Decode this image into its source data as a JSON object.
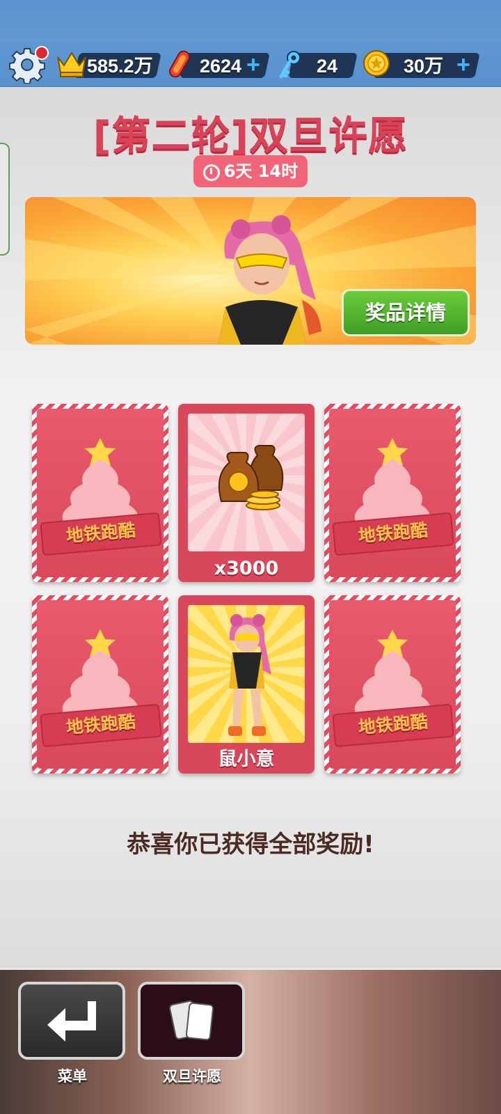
{
  "resources": {
    "score": "585.2万",
    "hoverboards": "2624",
    "keys": "24",
    "coins": "30万"
  },
  "event": {
    "title": "[第二轮]双旦许愿",
    "timer": "6天 14时",
    "detail_button": "奖品详情"
  },
  "cards": [
    {
      "state": "wrapped",
      "label": "地铁跑酷"
    },
    {
      "state": "revealed",
      "reward": "coin-bags",
      "label": "x3000"
    },
    {
      "state": "wrapped",
      "label": "地铁跑酷"
    },
    {
      "state": "wrapped",
      "label": "地铁跑酷"
    },
    {
      "state": "revealed",
      "reward": "character",
      "label": "鼠小意"
    },
    {
      "state": "wrapped",
      "label": "地铁跑酷"
    }
  ],
  "message": "恭喜你已获得全部奖励!",
  "bottom_nav": {
    "menu_label": "菜单",
    "event_label": "双旦许愿"
  },
  "colors": {
    "accent_red": "#d84358",
    "green_button": "#4fb12e",
    "top_blue": "#5b93cf"
  }
}
